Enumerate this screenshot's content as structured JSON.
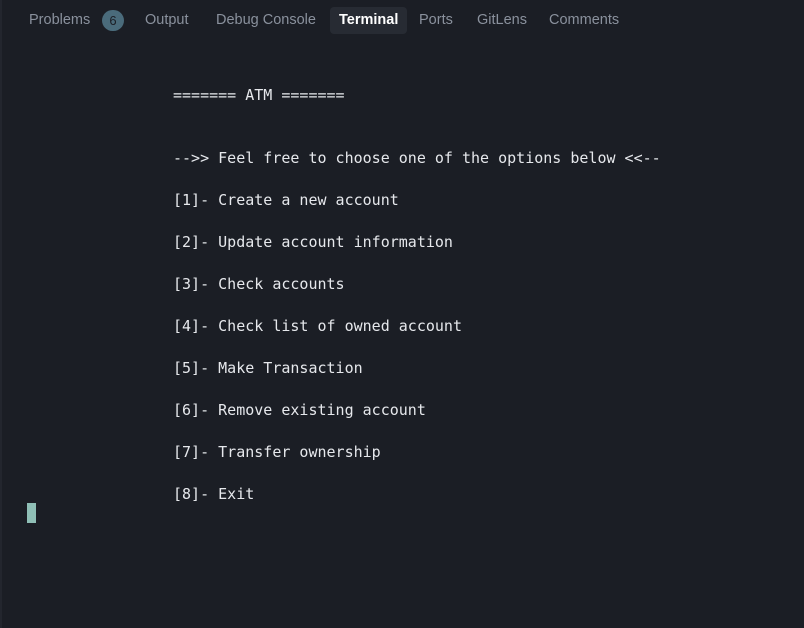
{
  "tabs": [
    {
      "label": "Problems",
      "badge": "6"
    },
    {
      "label": "Output"
    },
    {
      "label": "Debug Console"
    },
    {
      "label": "Terminal",
      "active": true
    },
    {
      "label": "Ports"
    },
    {
      "label": "GitLens"
    },
    {
      "label": "Comments"
    }
  ],
  "terminal": {
    "lines": [
      "======= ATM =======",
      "-->> Feel free to choose one of the options below <<--",
      "[1]- Create a new account",
      "[2]- Update account information",
      "[3]- Check accounts",
      "[4]- Check list of owned account",
      "[5]- Make Transaction",
      "[6]- Remove existing account",
      "[7]- Transfer ownership",
      "[8]- Exit"
    ]
  },
  "colors": {
    "background": "#1b1e25",
    "text": "#e6e8ec",
    "tab_inactive": "#8a919d",
    "tab_active_bg": "#272b33",
    "badge_bg": "#4a6b7b",
    "cursor": "#8fbfb6"
  }
}
